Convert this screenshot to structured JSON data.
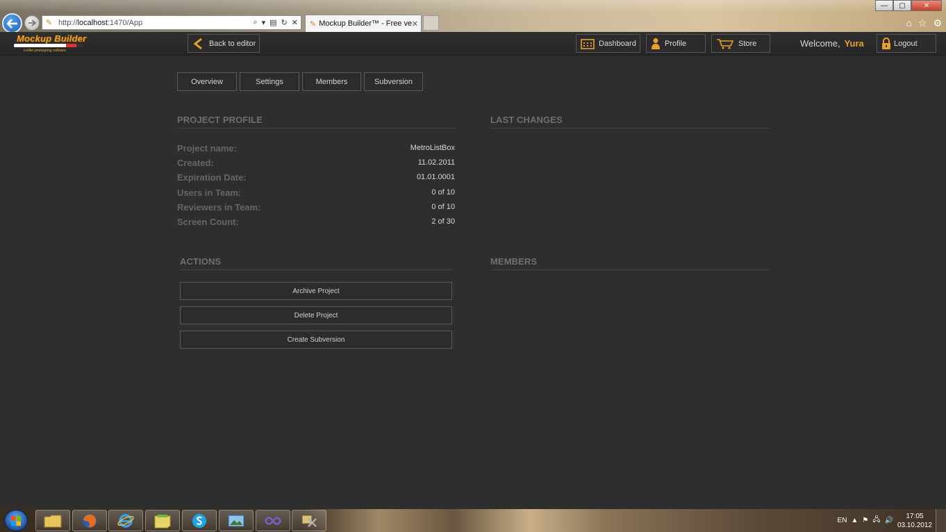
{
  "browser": {
    "url_prefix": "http://",
    "url_host": "localhost",
    "url_rest": ":1470/App",
    "tab_title": "Mockup Builder™ - Free ver...",
    "window_controls": {
      "minimize": "—",
      "maximize": "▢",
      "close": "✕"
    }
  },
  "app": {
    "logo_text": "Mockup Builder",
    "logo_tagline": "a killer prototyping software",
    "back_to_editor": "Back to editor",
    "dashboard": "Dashboard",
    "profile": "Profile",
    "store": "Store",
    "welcome": "Welcome,",
    "username": "Yura",
    "logout": "Logout",
    "accent_color": "#e8a12a"
  },
  "tabs": [
    {
      "label": "Overview"
    },
    {
      "label": "Settings"
    },
    {
      "label": "Members"
    },
    {
      "label": "Subversion"
    }
  ],
  "project_profile": {
    "title": "PROJECT PROFILE",
    "rows": [
      {
        "label": "Project name:",
        "value": "MetroListBox"
      },
      {
        "label": "Created:",
        "value": "11.02.2011"
      },
      {
        "label": "Expiration Date:",
        "value": "01.01.0001"
      },
      {
        "label": "Users in Team:",
        "value": "0 of 10"
      },
      {
        "label": "Reviewers in Team:",
        "value": "0 of 10"
      },
      {
        "label": "Screen Count:",
        "value": "2 of 30"
      }
    ]
  },
  "last_changes": {
    "title": "LAST CHANGES"
  },
  "actions": {
    "title": "ACTIONS",
    "buttons": [
      {
        "label": "Archive Project"
      },
      {
        "label": "Delete Project"
      },
      {
        "label": "Create Subversion"
      }
    ]
  },
  "members": {
    "title": "MEMBERS"
  },
  "taskbar": {
    "language": "EN",
    "time": "17:05",
    "date": "03.10.2012"
  }
}
